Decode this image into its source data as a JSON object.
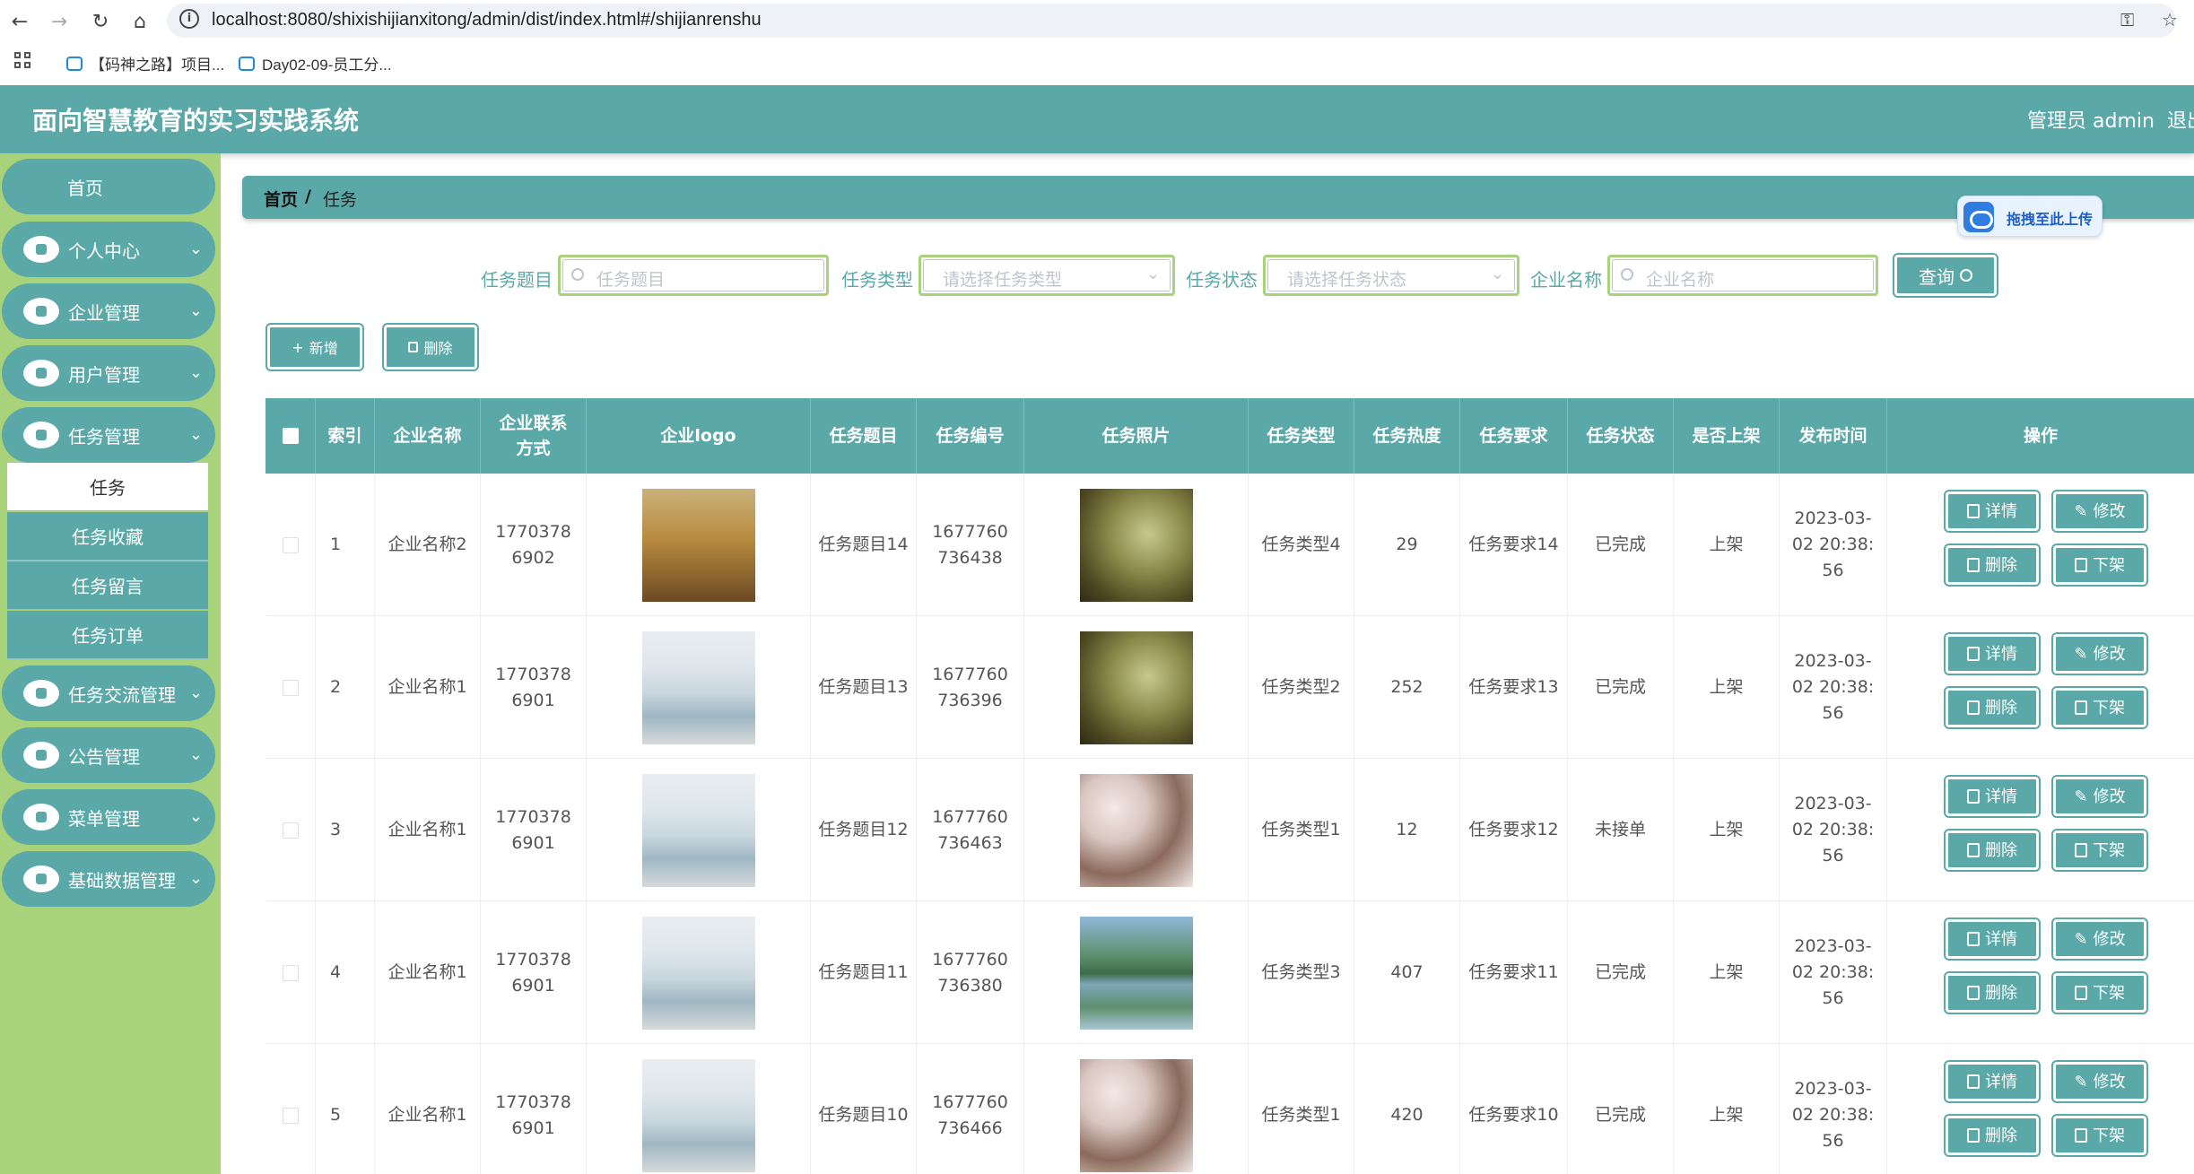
{
  "browser": {
    "url": "localhost:8080/shixishijianxitong/admin/dist/index.html#/shijianrenshu",
    "bookmarks": [
      "【码神之路】项目...",
      "Day02-09-员工分..."
    ]
  },
  "header": {
    "title": "面向智慧教育的实习实践系统",
    "user": "管理员 admin",
    "logout": "退出"
  },
  "sidebar": {
    "home": "首页",
    "menus": [
      "个人中心",
      "企业管理",
      "用户管理",
      "任务管理",
      "任务交流管理",
      "公告管理",
      "菜单管理",
      "基础数据管理"
    ],
    "submenu": [
      "任务",
      "任务收藏",
      "任务留言",
      "任务订单"
    ]
  },
  "breadcrumb": {
    "home": "首页",
    "sep": "/",
    "current": "任务"
  },
  "upload_badge": "拖拽至此上传",
  "filters": {
    "title_label": "任务题目",
    "title_placeholder": "任务题目",
    "type_label": "任务类型",
    "type_placeholder": "请选择任务类型",
    "status_label": "任务状态",
    "status_placeholder": "请选择任务状态",
    "company_label": "企业名称",
    "company_placeholder": "企业名称",
    "query": "查询"
  },
  "actions": {
    "add": "新增",
    "delete": "删除"
  },
  "table": {
    "headers": [
      "索引",
      "企业名称",
      "企业联系方式",
      "企业logo",
      "任务题目",
      "任务编号",
      "任务照片",
      "任务类型",
      "任务热度",
      "任务要求",
      "任务状态",
      "是否上架",
      "发布时间",
      "操作"
    ],
    "ops": {
      "detail": "详情",
      "edit": "修改",
      "delete": "删除",
      "offshelf": "下架"
    },
    "rows": [
      {
        "index": "1",
        "company": "企业名称2",
        "phone": "17703786902",
        "logo": "office",
        "title": "任务题目14",
        "code": "1677760736438",
        "photo": "forest",
        "type": "任务类型4",
        "heat": "29",
        "req": "任务要求14",
        "status": "已完成",
        "shelf": "上架",
        "time": "2023-03-02 20:38:56"
      },
      {
        "index": "2",
        "company": "企业名称1",
        "phone": "17703786901",
        "logo": "building",
        "title": "任务题目13",
        "code": "1677760736396",
        "photo": "forest",
        "type": "任务类型2",
        "heat": "252",
        "req": "任务要求13",
        "status": "已完成",
        "shelf": "上架",
        "time": "2023-03-02 20:38:56"
      },
      {
        "index": "3",
        "company": "企业名称1",
        "phone": "17703786901",
        "logo": "building",
        "title": "任务题目12",
        "code": "1677760736463",
        "photo": "blossom",
        "type": "任务类型1",
        "heat": "12",
        "req": "任务要求12",
        "status": "未接单",
        "shelf": "上架",
        "time": "2023-03-02 20:38:56"
      },
      {
        "index": "4",
        "company": "企业名称1",
        "phone": "17703786901",
        "logo": "building",
        "title": "任务题目11",
        "code": "1677760736380",
        "photo": "lake",
        "type": "任务类型3",
        "heat": "407",
        "req": "任务要求11",
        "status": "已完成",
        "shelf": "上架",
        "time": "2023-03-02 20:38:56"
      },
      {
        "index": "5",
        "company": "企业名称1",
        "phone": "17703786901",
        "logo": "building",
        "title": "任务题目10",
        "code": "1677760736466",
        "photo": "blossom",
        "type": "任务类型1",
        "heat": "420",
        "req": "任务要求10",
        "status": "已完成",
        "shelf": "上架",
        "time": "2023-03-02 20:38:56"
      }
    ]
  },
  "colors": {
    "primary": "#5ba8a8",
    "sidebar": "#a8d37a"
  }
}
